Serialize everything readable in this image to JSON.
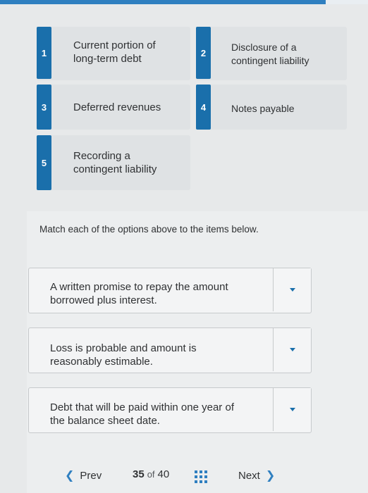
{
  "options": [
    {
      "num": "1",
      "text_line1": "Current portion of",
      "text_line2": "long-term debt"
    },
    {
      "num": "2",
      "text_line1": "Disclosure of a",
      "text_line2": "contingent liability"
    },
    {
      "num": "3",
      "text": "Deferred revenues"
    },
    {
      "num": "4",
      "text": "Notes payable"
    },
    {
      "num": "5",
      "text_line1": "Recording a",
      "text_line2": "contingent liability"
    }
  ],
  "instruction": "Match each of the options above to the items below.",
  "items": [
    {
      "line1": "A written promise to repay the amount",
      "line2": "borrowed plus interest."
    },
    {
      "line1": "Loss is probable and amount is",
      "line2": "reasonably estimable."
    },
    {
      "line1": "Debt that will be paid within one year of",
      "line2": "the balance sheet date."
    }
  ],
  "footer": {
    "prev_label": "Prev",
    "current_page": "35",
    "of_label": "of",
    "total_pages": "40",
    "next_label": "Next"
  },
  "colors": {
    "accent": "#1a6fab",
    "link": "#2f7fc0"
  }
}
